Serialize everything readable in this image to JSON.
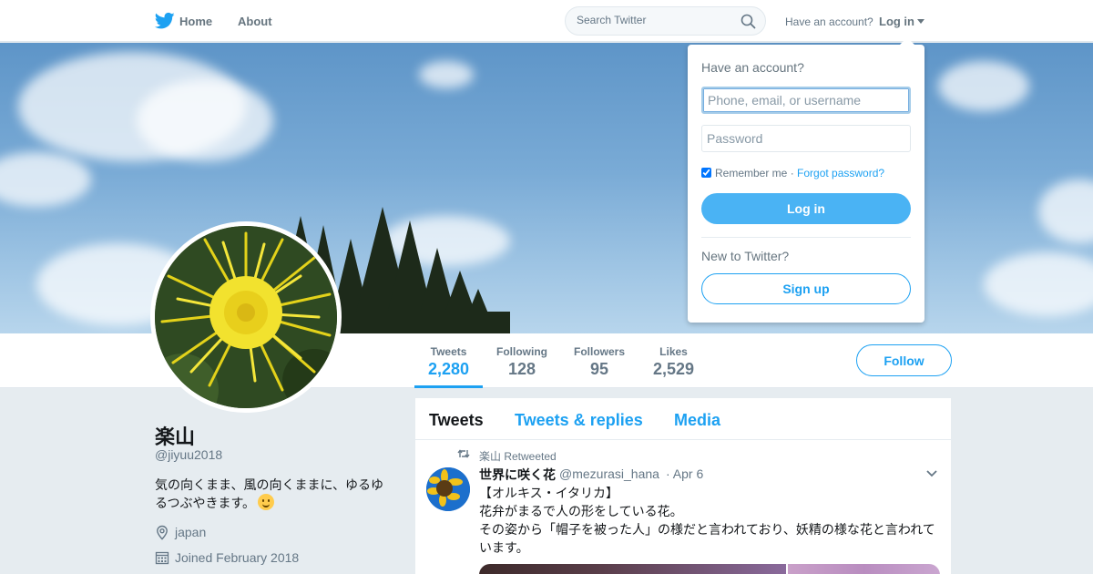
{
  "nav": {
    "logo_icon": "twitter-bird-icon",
    "home": "Home",
    "about": "About",
    "search_placeholder": "Search Twitter",
    "have_account": "Have an account?",
    "login": "Log in"
  },
  "profile": {
    "name": "楽山",
    "handle": "@jiyuu2018",
    "bio_line1": "気の向くまま、風の向くままに、ゆるゆ",
    "bio_line2": "るつぶやきます。",
    "location": "japan",
    "joined": "Joined February 2018",
    "follow_button": "Follow"
  },
  "stats": [
    {
      "label": "Tweets",
      "value": "2,280",
      "active": true
    },
    {
      "label": "Following",
      "value": "128"
    },
    {
      "label": "Followers",
      "value": "95"
    },
    {
      "label": "Likes",
      "value": "2,529"
    }
  ],
  "timeline": {
    "tabs": [
      "Tweets",
      "Tweets & replies",
      "Media"
    ],
    "retweet_text": "楽山 Retweeted",
    "tweet": {
      "name": "世界に咲く花",
      "handle": "@mezurasi_hana",
      "date": "· Apr 6",
      "line1": "【オルキス・イタリカ】",
      "line2": "花弁がまるで人の形をしている花。",
      "line3": "その姿から「帽子を被った人」の様だと言われており、妖精の様な花と言われています。"
    }
  },
  "login_dropdown": {
    "title": "Have an account?",
    "username_placeholder": "Phone, email, or username",
    "password_placeholder": "Password",
    "remember": "Remember me",
    "separator": " · ",
    "forgot": "Forgot password?",
    "login_button": "Log in",
    "new_to_twitter": "New to Twitter?",
    "signup_button": "Sign up"
  },
  "colors": {
    "accent": "#1da1f2",
    "login_button": "#4ab3f4",
    "page_background": "#e6ecf0"
  }
}
